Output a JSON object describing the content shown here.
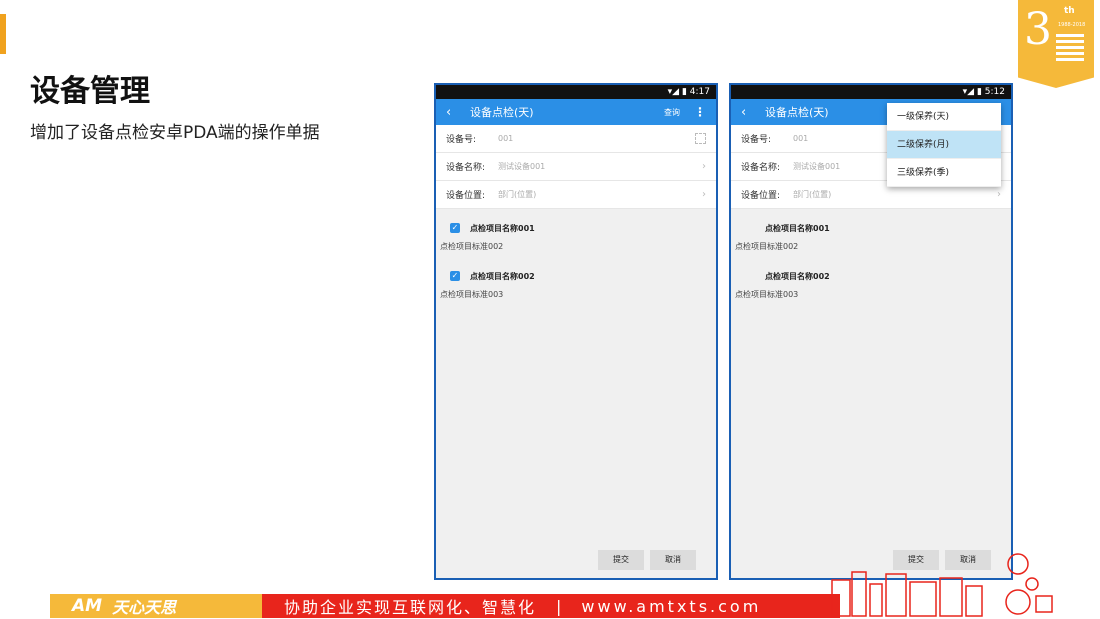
{
  "slide": {
    "title": "设备管理",
    "subtitle": "增加了设备点检安卓PDA端的操作单据"
  },
  "badge": {
    "number": "3",
    "years": "1988-2018",
    "th": "th"
  },
  "phone1": {
    "time": "4:17",
    "title": "设备点检(天)",
    "query": "查询",
    "rows": [
      {
        "label": "设备号:",
        "value": "001"
      },
      {
        "label": "设备名称:",
        "value": "测试设备001"
      },
      {
        "label": "设备位置:",
        "value": "部门(位置)"
      }
    ],
    "items": [
      {
        "name": "点检项目名称001",
        "standard": "点检项目标准002",
        "checked": true
      },
      {
        "name": "点检项目名称002",
        "standard": "点检项目标准003",
        "checked": true
      }
    ],
    "submit": "提交",
    "cancel": "取消"
  },
  "phone2": {
    "time": "5:12",
    "title": "设备点检(天)",
    "rows": [
      {
        "label": "设备号:",
        "value": "001"
      },
      {
        "label": "设备名称:",
        "value": "测试设备001"
      },
      {
        "label": "设备位置:",
        "value": "部门(位置)"
      }
    ],
    "items": [
      {
        "name": "点检项目名称001",
        "standard": "点检项目标准002",
        "checked": false
      },
      {
        "name": "点检项目名称002",
        "standard": "点检项目标准003",
        "checked": false
      }
    ],
    "dropdown": [
      "一级保养(天)",
      "二级保养(月)",
      "三级保养(季)"
    ],
    "dropdown_selected": "二级保养(月)",
    "submit": "提交",
    "cancel": "取消"
  },
  "footer": {
    "logo": "AM",
    "brand": "天心天思",
    "slogan": "协助企业实现互联网化、智慧化",
    "separator": "|",
    "website": "www.amtxts.com"
  },
  "colors": {
    "accent": "#f0a21e",
    "primary": "#2b8fe6",
    "footer": "#e8251c"
  }
}
